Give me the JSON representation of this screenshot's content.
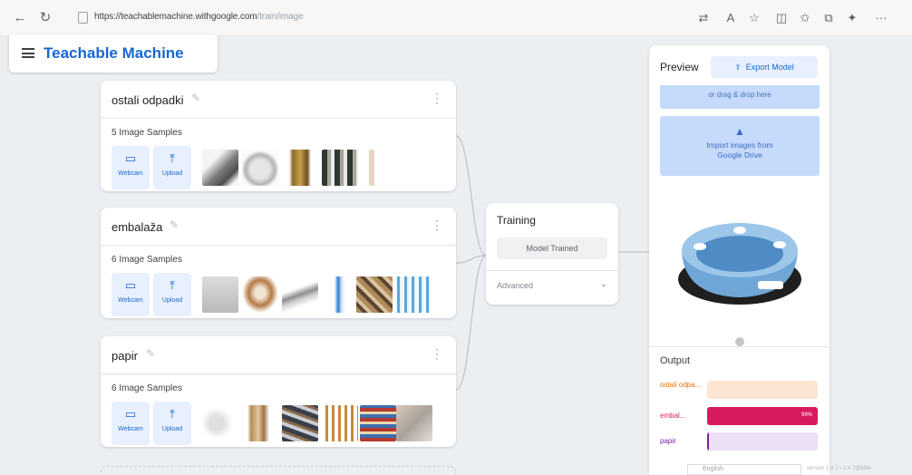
{
  "browser": {
    "url_main": "https://teachablemachine.withgoogle.com",
    "url_path": "/train/image"
  },
  "app": {
    "title": "Teachable Machine"
  },
  "classes": [
    {
      "name": "ostali odpadki",
      "samples": "5 Image Samples",
      "webcam": "Webcam",
      "upload": "Upload"
    },
    {
      "name": "embalaža",
      "samples": "6 Image Samples",
      "webcam": "Webcam",
      "upload": "Upload"
    },
    {
      "name": "papir",
      "samples": "6 Image Samples",
      "webcam": "Webcam",
      "upload": "Upload"
    }
  ],
  "training": {
    "title": "Training",
    "button": "Model Trained",
    "advanced": "Advanced"
  },
  "preview": {
    "title": "Preview",
    "export": "Export Model",
    "drop_text": "or drag & drop here",
    "drive_line1": "Import images from",
    "drive_line2": "Google Drive",
    "output_title": "Output",
    "outputs": [
      {
        "label": "ostali odpa...",
        "value": 0.0,
        "color": "#e8710a",
        "bg": "#fde5d3"
      },
      {
        "label": "embal...",
        "value": 1.0,
        "pct": "99%",
        "color": "#d81b60",
        "bg": "#f8cfe0"
      },
      {
        "label": "papir",
        "value": 0.01,
        "color": "#7b1fa2",
        "bg": "#ece0f5"
      }
    ]
  },
  "footer": {
    "language": "English",
    "version": "version 2.4.7 • 2.4.7@b6fe"
  },
  "colors": {
    "accent": "#1967d2",
    "drive_bg": "#c6dafc"
  }
}
